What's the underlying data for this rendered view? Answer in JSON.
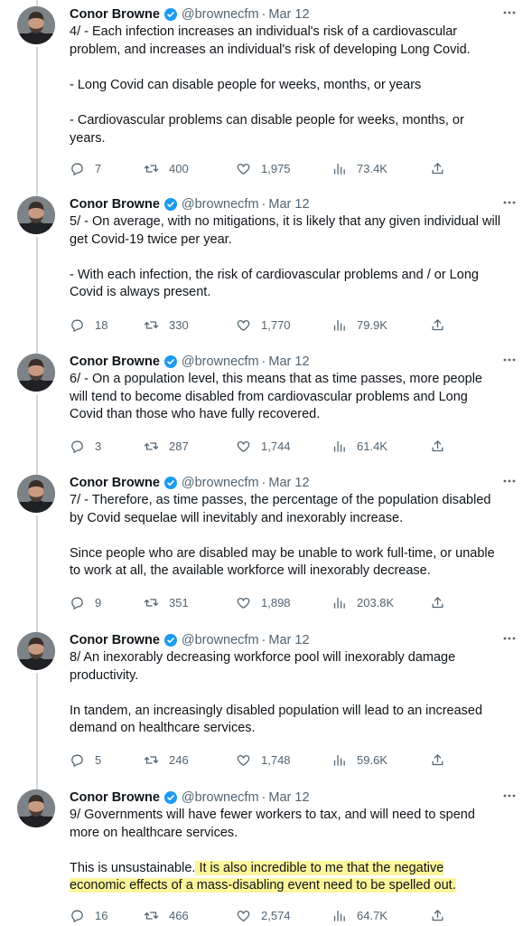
{
  "tweets": [
    {
      "name": "Conor Browne",
      "handle": "@brownecfm",
      "separator": "·",
      "date": "Mar 12",
      "paragraphs": [
        "4/ - Each infection increases an individual's risk of a cardiovascular problem, and increases an individual's risk of developing Long Covid.",
        "- Long Covid can disable people for weeks, months, or years",
        "- Cardiovascular problems can disable people for weeks, months, or years."
      ],
      "replies": "7",
      "retweets": "400",
      "likes": "1,975",
      "views": "73.4K"
    },
    {
      "name": "Conor Browne",
      "handle": "@brownecfm",
      "separator": "·",
      "date": "Mar 12",
      "paragraphs": [
        "5/ - On average, with no mitigations, it is likely that any given individual will get Covid-19 twice per year.",
        "- With each infection, the risk of cardiovascular problems and / or Long Covid is always present."
      ],
      "replies": "18",
      "retweets": "330",
      "likes": "1,770",
      "views": "79.9K"
    },
    {
      "name": "Conor Browne",
      "handle": "@brownecfm",
      "separator": "·",
      "date": "Mar 12",
      "paragraphs": [
        "6/ - On a population level, this means that as time passes, more people will tend to become disabled from cardiovascular problems and Long Covid than those who have fully recovered."
      ],
      "replies": "3",
      "retweets": "287",
      "likes": "1,744",
      "views": "61.4K"
    },
    {
      "name": "Conor Browne",
      "handle": "@brownecfm",
      "separator": "·",
      "date": "Mar 12",
      "paragraphs": [
        "7/ - Therefore, as time passes, the percentage of the population disabled by Covid sequelae will inevitably and inexorably increase.",
        "Since people who are disabled may be unable to work full-time, or unable to work at all, the available workforce will inexorably decrease."
      ],
      "replies": "9",
      "retweets": "351",
      "likes": "1,898",
      "views": "203.8K"
    },
    {
      "name": "Conor Browne",
      "handle": "@brownecfm",
      "separator": "·",
      "date": "Mar 12",
      "paragraphs": [
        "8/ An inexorably decreasing workforce pool will inexorably damage productivity.",
        "In tandem, an increasingly disabled population will lead to an increased demand on healthcare services."
      ],
      "replies": "5",
      "retweets": "246",
      "likes": "1,748",
      "views": "59.6K"
    },
    {
      "name": "Conor Browne",
      "handle": "@brownecfm",
      "separator": "·",
      "date": "Mar 12",
      "paragraphs": [
        "9/ Governments will have fewer workers to tax, and will need to spend more on healthcare services."
      ],
      "last_plain": "This is unsustainable.",
      "last_highlight": " It is also incredible to me that the negative economic effects of a mass-disabling event need to be spelled out.",
      "replies": "16",
      "retweets": "466",
      "likes": "2,574",
      "views": "64.7K"
    }
  ],
  "icons": {
    "verified": "verified-badge-icon",
    "more": "more-icon",
    "reply": "reply-icon",
    "retweet": "retweet-icon",
    "like": "heart-icon",
    "views": "views-icon",
    "share": "share-icon"
  },
  "colors": {
    "text": "#0f1419",
    "secondary": "#536471",
    "verified": "#1d9bf0",
    "highlight": "#fdf59a",
    "thread_line": "#cfd9de"
  }
}
